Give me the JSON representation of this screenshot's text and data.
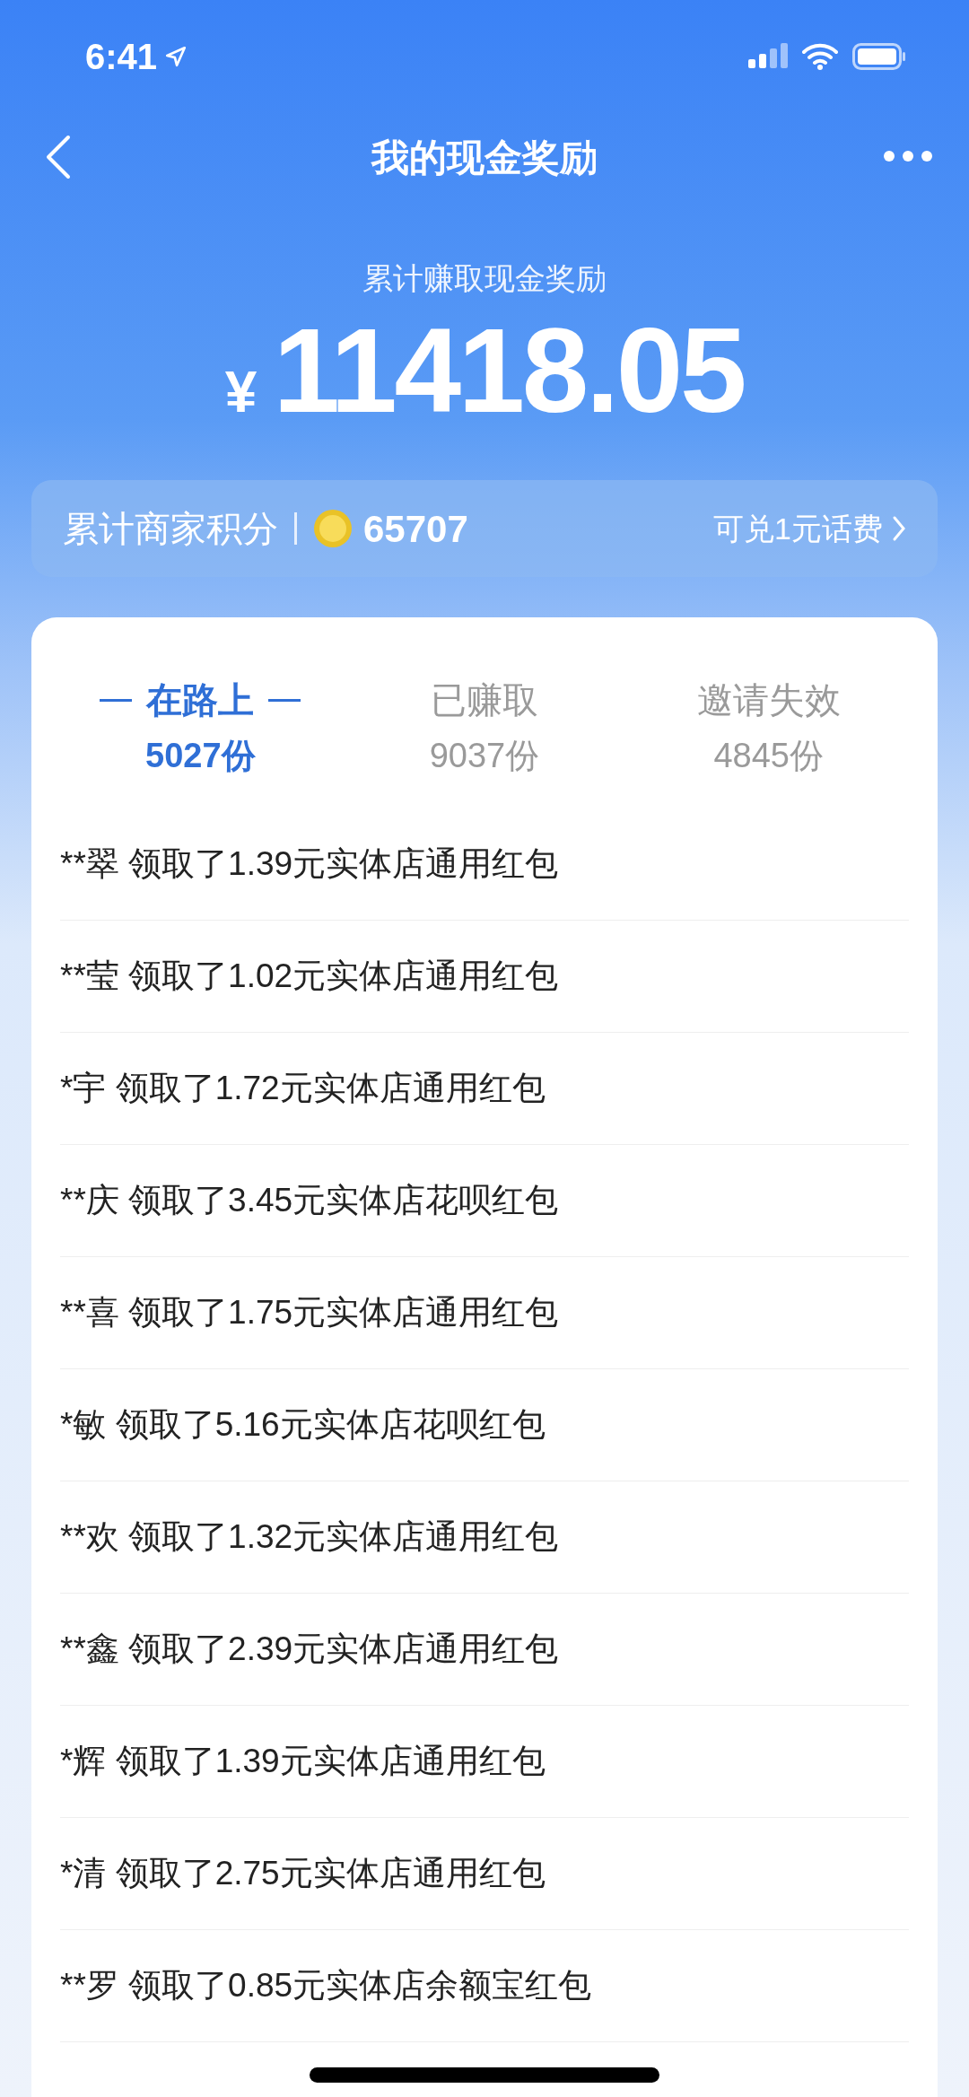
{
  "status_bar": {
    "time": "6:41"
  },
  "nav": {
    "title": "我的现金奖励"
  },
  "summary": {
    "label": "累计赚取现金奖励",
    "currency": "¥",
    "amount": "11418.05"
  },
  "points_bar": {
    "label": "累计商家积分",
    "value": "65707",
    "action": "可兑1元话费"
  },
  "tabs": [
    {
      "label": "在路上",
      "count": "5027份",
      "selected": true
    },
    {
      "label": "已赚取",
      "count": "9037份",
      "selected": false
    },
    {
      "label": "邀请失效",
      "count": "4845份",
      "selected": false
    }
  ],
  "records": [
    "**翠 领取了1.39元实体店通用红包",
    "**莹 领取了1.02元实体店通用红包",
    "*宇 领取了1.72元实体店通用红包",
    "**庆 领取了3.45元实体店花呗红包",
    "**喜 领取了1.75元实体店通用红包",
    "*敏 领取了5.16元实体店花呗红包",
    "**欢 领取了1.32元实体店通用红包",
    "**鑫 领取了2.39元实体店通用红包",
    "*辉 领取了1.39元实体店通用红包",
    "*清 领取了2.75元实体店通用红包",
    "**罗 领取了0.85元实体店余额宝红包"
  ]
}
